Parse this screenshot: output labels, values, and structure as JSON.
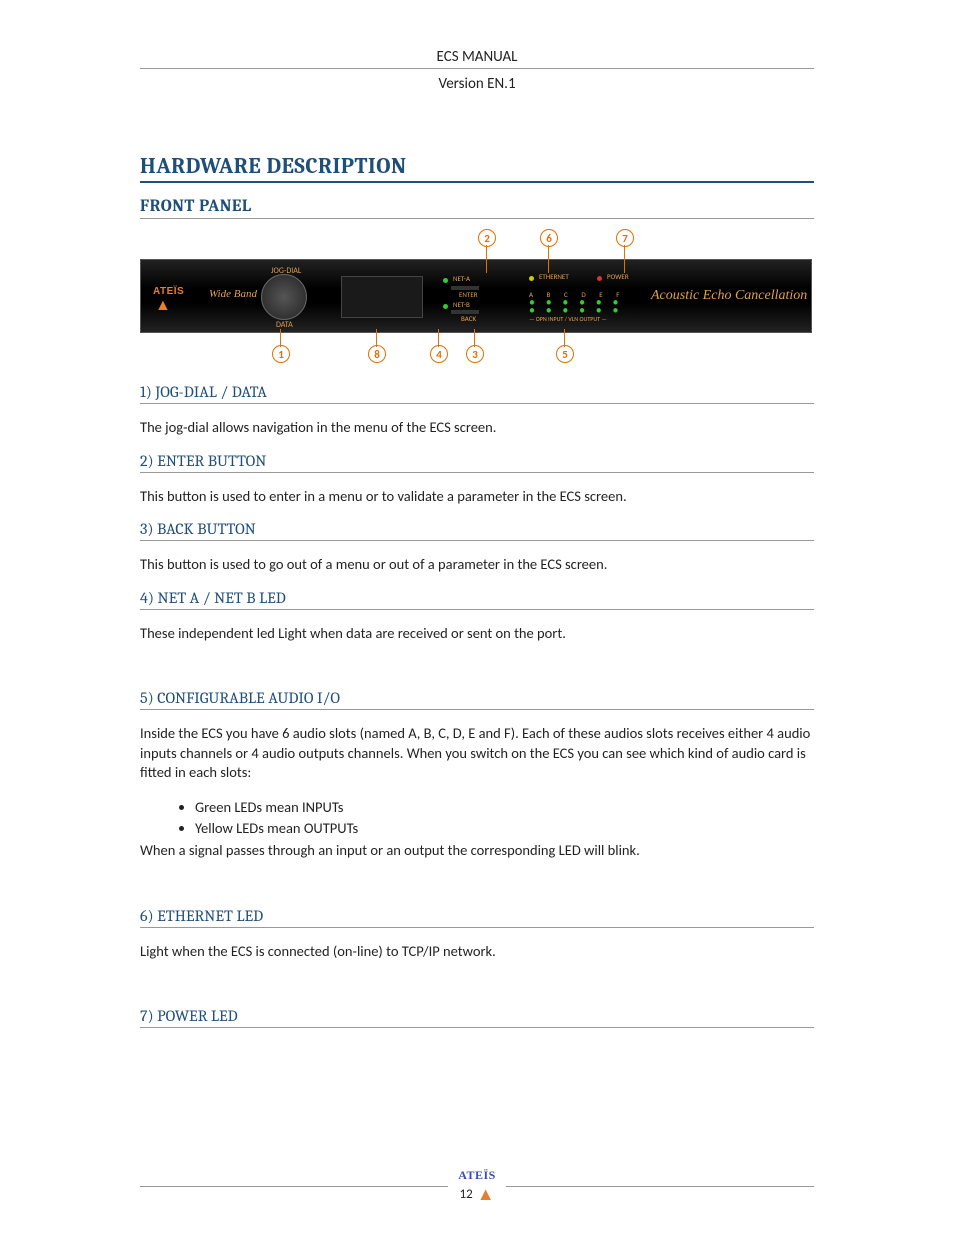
{
  "header": {
    "title": "ECS  MANUAL",
    "version": "Version EN.1"
  },
  "h1": "HARDWARE DESCRIPTION",
  "h2": "FRONT PANEL",
  "panel": {
    "brand": "ATEÏS",
    "wideband": "Wide Band",
    "jog_label": "JOG-DIAL",
    "data_label": "DATA",
    "enter": "ENTER",
    "back": "BACK",
    "neta": "NET-A",
    "netb": "NET-B",
    "ethernet": "ETHERNET",
    "power": "POWER",
    "slot_letters": "A  B  C  D  E  F",
    "slot_foot": "— OPN INPUT / VLN OUTPUT —",
    "cursive": "Acoustic Echo Cancellation",
    "callouts": {
      "1": "1",
      "2": "2",
      "3": "3",
      "4": "4",
      "5": "5",
      "6": "6",
      "7": "7",
      "8": "8"
    }
  },
  "sections": [
    {
      "heading": "1) JOG-DIAL / DATA",
      "text": "The jog-dial allows navigation in the menu of the ECS screen."
    },
    {
      "heading": "2) ENTER BUTTON",
      "text": "This button is used to enter in a menu or to validate a parameter in the ECS screen."
    },
    {
      "heading": "3) BACK BUTTON",
      "text": "This button is used to go out of a menu or out of a parameter in the ECS screen."
    },
    {
      "heading": "4) NET A / NET B LED",
      "text": "These independent led Light when data are received or sent on the port."
    }
  ],
  "section5": {
    "heading": "5) CONFIGURABLE AUDIO I/O",
    "intro": "Inside the ECS you have 6 audio slots (named A, B, C, D, E and F). Each of these audios slots receives either 4 audio inputs channels or 4 audio outputs channels. When you switch on the ECS you can see which kind of audio card is fitted in each slots:",
    "bullets": [
      "Green LEDs mean INPUTs",
      "Yellow LEDs mean OUTPUTs"
    ],
    "outro": "When a signal passes through an input or an output the corresponding LED will blink."
  },
  "section6": {
    "heading": "6) ETHERNET LED",
    "text": "Light when the ECS is connected (on-line) to TCP/IP network."
  },
  "section7": {
    "heading": "7) POWER LED"
  },
  "footer": {
    "brand": "ATEÏS",
    "page": "12"
  }
}
